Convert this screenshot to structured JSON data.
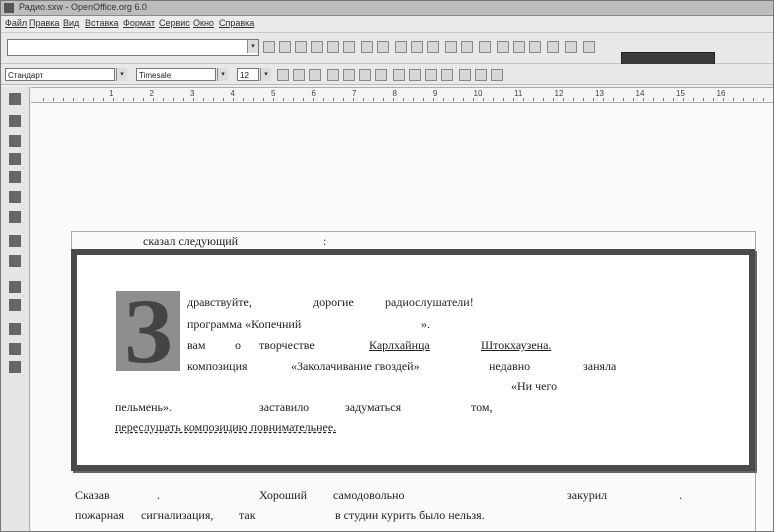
{
  "window": {
    "title": "Радио.sxw - OpenOffice.org 6.0"
  },
  "menubar": {
    "items": [
      "Файл",
      "Правка",
      "Вид",
      "Вставка",
      "Формат",
      "Сервис",
      "Окно",
      "Справка"
    ]
  },
  "toolbar": {
    "url_value": "",
    "dropdown_arrow": "▾"
  },
  "formatting": {
    "style": "Стандарт",
    "font": "Timesale",
    "size": "12"
  },
  "ruler": {
    "numbers": [
      "1",
      "2",
      "3",
      "4",
      "5",
      "6",
      "7",
      "8",
      "9",
      "10",
      "11",
      "12",
      "13",
      "14",
      "15",
      "16"
    ]
  },
  "document": {
    "line_top": "сказал следующий",
    "line_top_colon": ":",
    "dropcap": "З",
    "p1": [
      "дравствуйте,",
      "дорогие",
      "радиослушатели!"
    ],
    "p2": [
      "программа «Копечний",
      "»."
    ],
    "p3": [
      "вам",
      "о",
      "творчестве",
      "Карлхайнца",
      "Штокхаузена."
    ],
    "p4": [
      "композиция",
      "«Заколачивание гвоздей»",
      "недавно",
      "заняла"
    ],
    "p5": "«Ни чего",
    "p6": [
      "пельмень».",
      "заставило",
      "задуматься",
      "том,"
    ],
    "p7": "переслушать композицию повнимательнее.",
    "bottom1": [
      "Сказав",
      ".",
      "Хороший",
      "самодовольно",
      "закурил",
      "."
    ],
    "bottom2": [
      "пожарная",
      "сигнализация,",
      "так",
      "в студии курить было нельзя."
    ]
  },
  "colors": {
    "frame": "#4a4a4a",
    "dropcap_bg": "#8e8e8e"
  }
}
